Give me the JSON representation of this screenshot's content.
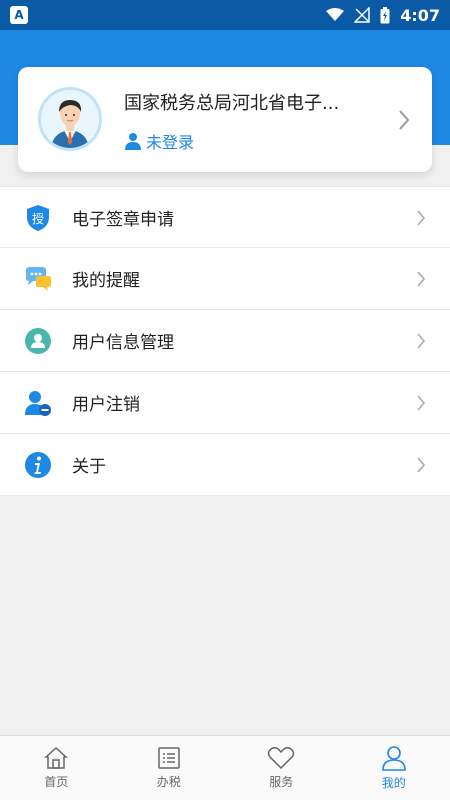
{
  "status_bar": {
    "left_badge": "A",
    "time": "4:07"
  },
  "profile": {
    "title": "国家税务总局河北省电子...",
    "login_status": "未登录",
    "icon": "user-icon"
  },
  "menu": {
    "items": [
      {
        "label": "电子签章申请",
        "icon": "shield-auth-icon",
        "badge_text": "授"
      },
      {
        "label": "我的提醒",
        "icon": "chat-bubbles-icon"
      },
      {
        "label": "用户信息管理",
        "icon": "user-info-icon"
      },
      {
        "label": "用户注销",
        "icon": "user-remove-icon"
      },
      {
        "label": "关于",
        "icon": "info-icon"
      }
    ]
  },
  "tabs": [
    {
      "label": "首页",
      "icon": "home-icon",
      "active": false
    },
    {
      "label": "办税",
      "icon": "list-icon",
      "active": false
    },
    {
      "label": "服务",
      "icon": "heart-icon",
      "active": false
    },
    {
      "label": "我的",
      "icon": "person-icon",
      "active": true
    }
  ],
  "colors": {
    "primary": "#1e88e5",
    "status_bar": "#0b5aa6",
    "background": "#f0f0f0"
  }
}
